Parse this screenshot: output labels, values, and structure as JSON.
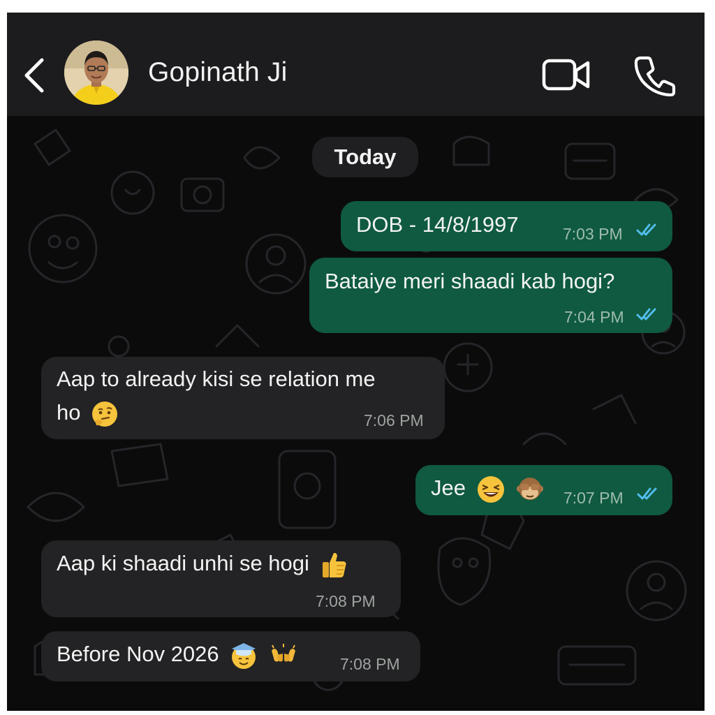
{
  "header": {
    "contact_name": "Gopinath Ji"
  },
  "chat": {
    "date_label": "Today",
    "messages": [
      {
        "direction": "outgoing",
        "text": "DOB - 14/8/1997",
        "time": "7:03 PM",
        "status": "read"
      },
      {
        "direction": "outgoing",
        "text": "Bataiye meri shaadi kab hogi?",
        "time": "7:04 PM",
        "status": "read"
      },
      {
        "direction": "incoming",
        "text_line1": "Aap to already kisi se relation me",
        "text_line2": "ho",
        "emoji": "thinking-face",
        "time": "7:06 PM"
      },
      {
        "direction": "outgoing",
        "text": "Jee",
        "emojis": [
          "grinning-squinting-face",
          "see-no-evil-monkey"
        ],
        "time": "7:07 PM",
        "status": "read"
      },
      {
        "direction": "incoming",
        "text": "Aap ki shaadi unhi se hogi",
        "emoji": "thumbs-up",
        "time": "7:08 PM"
      },
      {
        "direction": "incoming",
        "text": "Before Nov 2026",
        "emojis": [
          "graduation-cap-face",
          "raised-hands"
        ],
        "time": "7:08 PM"
      }
    ]
  },
  "colors": {
    "header_bg": "#1c1c1e",
    "chat_bg": "#0b0b0c",
    "outgoing_bubble": "#0f5a41",
    "incoming_bubble": "#232325",
    "read_tick": "#53bdeb"
  }
}
